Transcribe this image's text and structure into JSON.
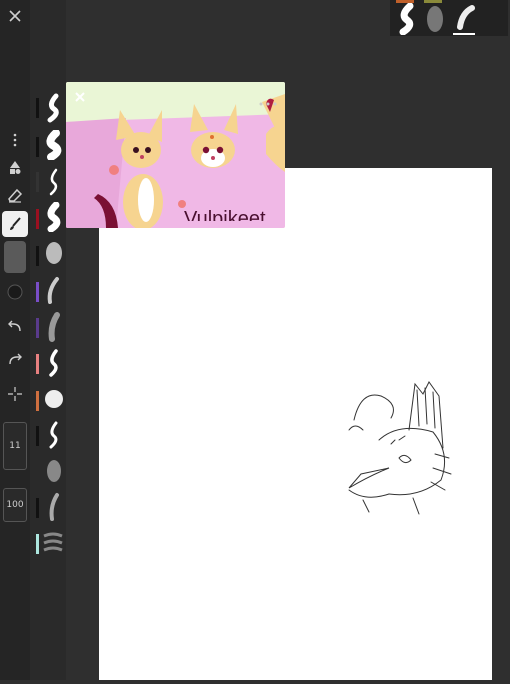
{
  "app": {
    "name": "drawing app"
  },
  "toolbar": {
    "items": [
      {
        "name": "close-icon"
      },
      {
        "name": "more-icon"
      },
      {
        "name": "shapes-icon"
      },
      {
        "name": "eraser-icon"
      },
      {
        "name": "brush-icon",
        "active": true
      },
      {
        "name": "layer-slot"
      },
      {
        "name": "color-circle"
      },
      {
        "name": "undo-icon"
      },
      {
        "name": "redo-icon"
      },
      {
        "name": "transform-icon"
      }
    ],
    "size_value": "11",
    "opacity_value": "100"
  },
  "brush_swatches": [
    "#111111",
    "#111111",
    "#333333",
    "#9b1020",
    "#111111",
    "#7a4ec8",
    "#5a3b8c",
    "#e88080",
    "#d07040",
    "#111111",
    "#2a2a2a",
    "#111111",
    "#aee8e0"
  ],
  "reference": {
    "title": "Vulpikeet",
    "close_icon": "close-icon",
    "more_icon": "more-icon"
  },
  "top_brushes": {
    "colors": [
      "#c0602a",
      "#8a8a3a"
    ],
    "active_index": 2
  }
}
